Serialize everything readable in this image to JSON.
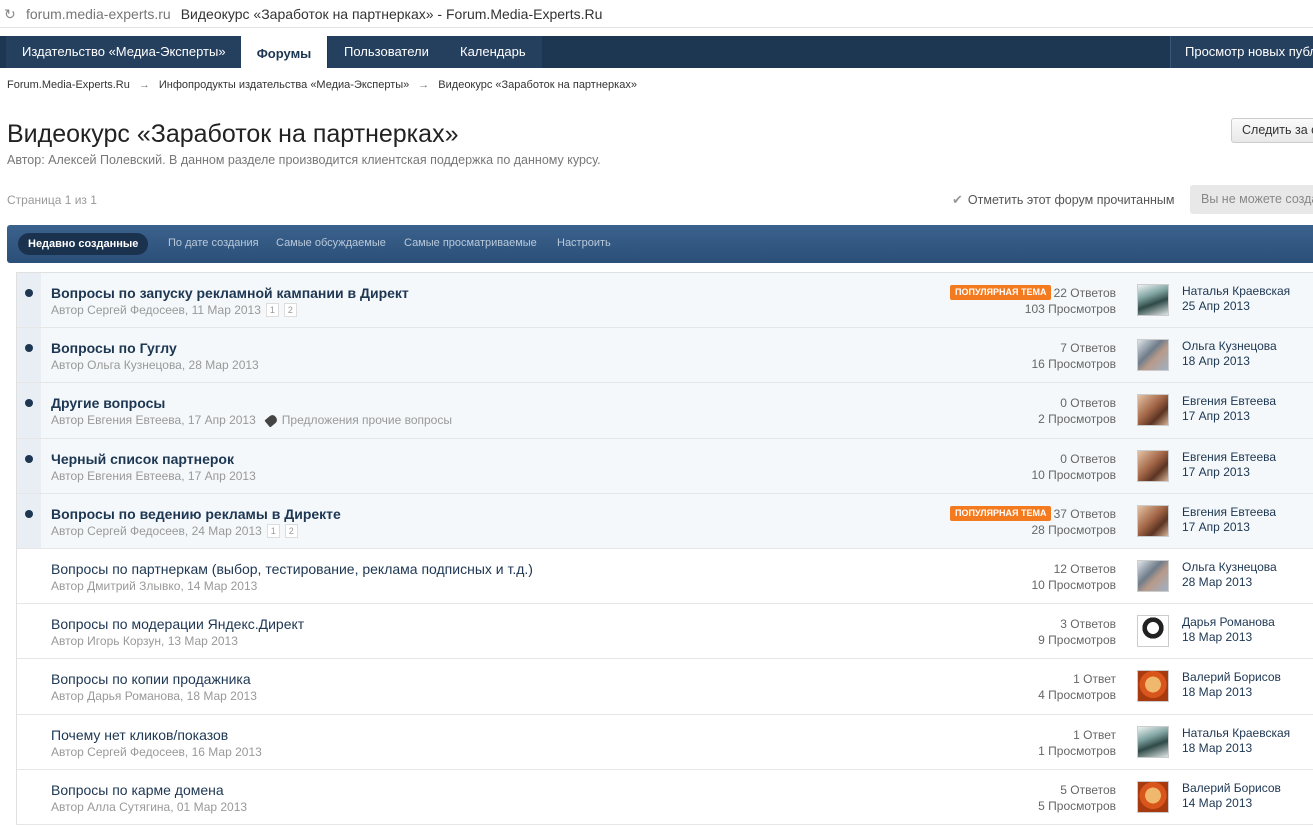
{
  "browser": {
    "url": "forum.media-experts.ru",
    "title": "Видеокурс «Заработок на партнерках» - Forum.Media-Experts.Ru"
  },
  "nav": {
    "tabs": [
      {
        "label": "Издательство «Медиа-Эксперты»",
        "active": false
      },
      {
        "label": "Форумы",
        "active": true
      },
      {
        "label": "Пользователи",
        "active": false
      },
      {
        "label": "Календарь",
        "active": false
      }
    ],
    "right_link": "Просмотр новых публ"
  },
  "breadcrumb": [
    "Forum.Media-Experts.Ru",
    "Инфопродукты издательства «Медиа-Эксперты»",
    "Видеокурс «Заработок на партнерках»"
  ],
  "page": {
    "title": "Видеокурс «Заработок на партнерках»",
    "description": "Автор: Алексей Полевский. В данном разделе производится клиентская поддержка по данному курсу.",
    "follow_button": "Следить за с",
    "pagination": "Страница 1 из 1",
    "mark_read": "Отметить этот форум прочитанным",
    "cant_create": "Вы не можете созда"
  },
  "filters": [
    "Недавно созданные",
    "По дате создания",
    "Самые обсуждаемые",
    "Самые просматриваемые",
    "Настроить"
  ],
  "hot_badge_label": "ПОПУЛЯРНАЯ ТЕМА",
  "topics": [
    {
      "title": "Вопросы по запуску рекламной кампании в Директ",
      "meta": "Автор Сергей Федосеев, 11 Мар 2013",
      "replies": "22 Ответов",
      "views": "103 Просмотров",
      "last_name": "Наталья Краевская",
      "last_date": "25 Апр 2013"
    },
    {
      "title": "Вопросы по Гуглу",
      "meta": "Автор Ольга Кузнецова, 28 Мар 2013",
      "replies": "7 Ответов",
      "views": "16 Просмотров",
      "last_name": "Ольга Кузнецова",
      "last_date": "18 Апр 2013"
    },
    {
      "title": "Другие вопросы",
      "meta": "Автор Евгения Евтеева, 17 Апр 2013",
      "tag": "Предложения прочие вопросы",
      "replies": "0 Ответов",
      "views": "2 Просмотров",
      "last_name": "Евгения Евтеева",
      "last_date": "17 Апр 2013"
    },
    {
      "title": "Черный список партнерок",
      "meta": "Автор Евгения Евтеева, 17 Апр 2013",
      "replies": "0 Ответов",
      "views": "10 Просмотров",
      "last_name": "Евгения Евтеева",
      "last_date": "17 Апр 2013"
    },
    {
      "title": "Вопросы по ведению рекламы в Директе",
      "meta": "Автор Сергей Федосеев, 24 Мар 2013",
      "replies": "37 Ответов",
      "views": "28 Просмотров",
      "last_name": "Евгения Евтеева",
      "last_date": "17 Апр 2013"
    },
    {
      "title": "Вопросы по партнеркам (выбор, тестирование, реклама подписных и т.д.)",
      "meta": "Автор Дмитрий Злывко, 14 Мар 2013",
      "replies": "12 Ответов",
      "views": "10 Просмотров",
      "last_name": "Ольга Кузнецова",
      "last_date": "28 Мар 2013"
    },
    {
      "title": "Вопросы по модерации Яндекс.Директ",
      "meta": "Автор Игорь Корзун, 13 Мар 2013",
      "replies": "3 Ответов",
      "views": "9 Просмотров",
      "last_name": "Дарья Романова",
      "last_date": "18 Мар 2013"
    },
    {
      "title": "Вопросы по копии продажника",
      "meta": "Автор Дарья Романова, 18 Мар 2013",
      "replies": "1 Ответ",
      "views": "4 Просмотров",
      "last_name": "Валерий Борисов",
      "last_date": "18 Мар 2013"
    },
    {
      "title": "Почему нет кликов/показов",
      "meta": "Автор Сергей Федосеев, 16 Мар 2013",
      "replies": "1 Ответ",
      "views": "1 Просмотров",
      "last_name": "Наталья Краевская",
      "last_date": "18 Мар 2013"
    },
    {
      "title": "Вопросы по карме домена",
      "meta": "Автор Алла Сутягина, 01 Мар 2013",
      "replies": "5 Ответов",
      "views": "5 Просмотров",
      "last_name": "Валерий Борисов",
      "last_date": "14 Мар 2013"
    }
  ],
  "topic_pages": [
    "1",
    "2"
  ],
  "colors": {
    "nav_bg": "#1d3652",
    "hot_badge": "#f47a1f",
    "link": "#1d3652"
  }
}
